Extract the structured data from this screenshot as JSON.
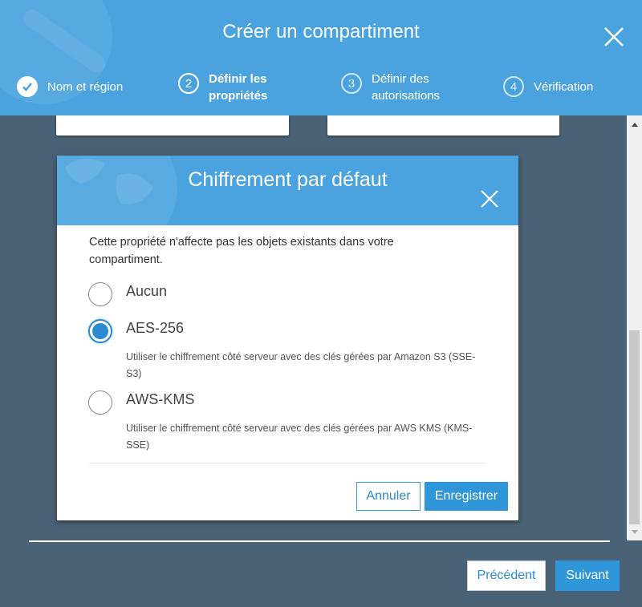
{
  "colors": {
    "accent": "#4aa3df",
    "primary_button": "#2f96d9",
    "backdrop": "#4a6275"
  },
  "header": {
    "title": "Créer un compartiment",
    "close_icon": "close-icon",
    "steps": [
      {
        "number": "",
        "label": "Nom et région",
        "state": "done",
        "icon": "checkmark-icon"
      },
      {
        "number": "2",
        "label": "Définir les propriétés",
        "state": "active"
      },
      {
        "number": "3",
        "label": "Définir des autorisations",
        "state": "inactive"
      },
      {
        "number": "4",
        "label": "Vérification",
        "state": "inactive"
      }
    ]
  },
  "modal": {
    "title": "Chiffrement par défaut",
    "close_icon": "close-icon",
    "description": "Cette propriété n'affecte pas les objets existants dans votre compartiment.",
    "options": [
      {
        "label": "Aucun",
        "description": "",
        "selected": false
      },
      {
        "label": "AES-256",
        "description": "Utiliser le chiffrement côté serveur avec des clés gérées par Amazon S3 (SSE-S3)",
        "selected": true
      },
      {
        "label": "AWS-KMS",
        "description": "Utiliser le chiffrement côté serveur avec des clés gérées par AWS KMS (KMS-SSE)",
        "selected": false
      }
    ],
    "cancel_label": "Annuler",
    "save_label": "Enregistrer"
  },
  "footer": {
    "prev_label": "Précédent",
    "next_label": "Suivant"
  }
}
